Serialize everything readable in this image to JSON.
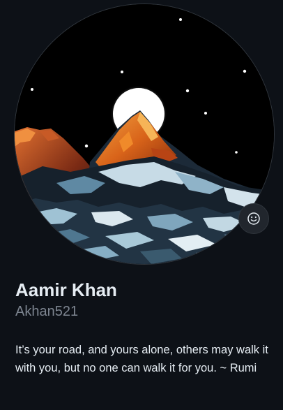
{
  "profile": {
    "display_name": "Aamir Khan",
    "username": "Akhan521",
    "bio": "It’s your road, and yours alone, others may walk it with you, but no one can walk it for you. ~ Rumi"
  },
  "avatar": {
    "alt": "Aamir Khan avatar"
  },
  "status_button": {
    "icon": "smiley-icon",
    "label": "Set status"
  },
  "colors": {
    "background": "#0d1117",
    "text_primary": "#e6edf3",
    "text_muted": "#7d8590",
    "border": "#30363d"
  }
}
